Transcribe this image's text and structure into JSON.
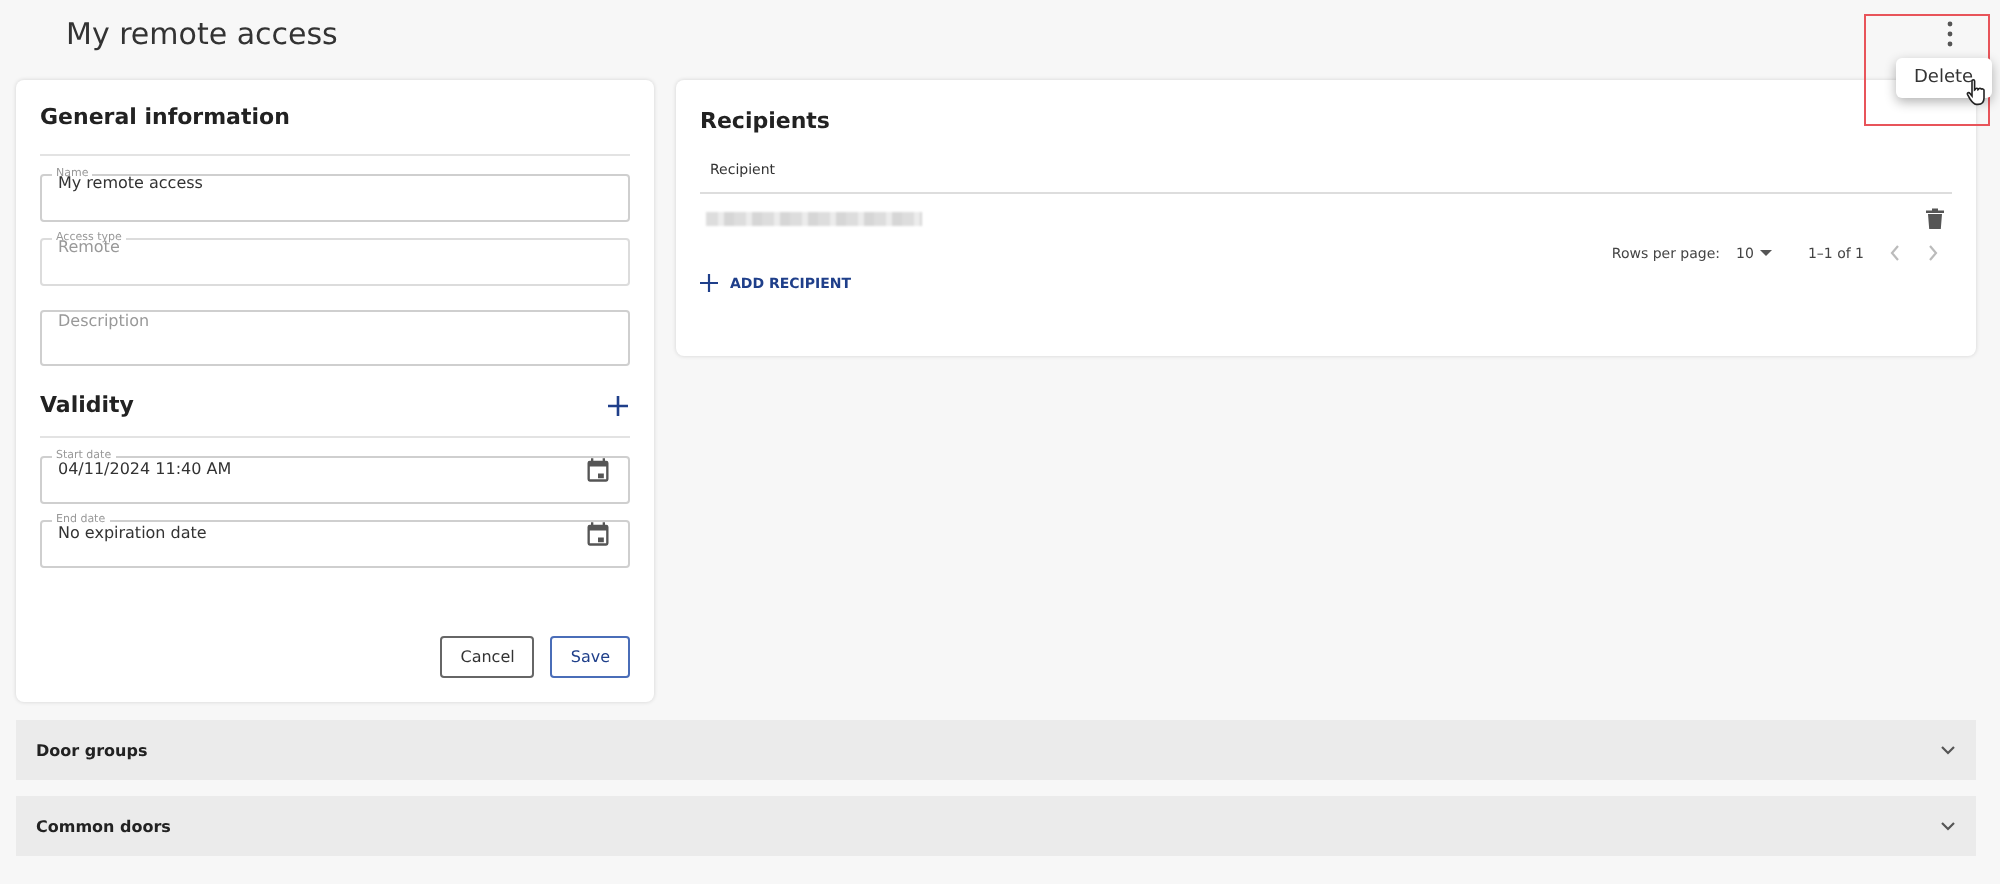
{
  "header": {
    "title": "My remote access",
    "menu": {
      "items": [
        {
          "label": "Delete"
        }
      ]
    }
  },
  "general": {
    "title": "General information",
    "fields": [
      {
        "label": "Name",
        "value": "My remote access"
      },
      {
        "label": "Access type",
        "value": "Remote",
        "disabled": true
      },
      {
        "placeholder": "Description"
      }
    ]
  },
  "validity": {
    "title": "Validity",
    "fields": [
      {
        "kind": "date",
        "label": "Start date",
        "value": "04/11/2024 11:40 AM"
      },
      {
        "kind": "date",
        "label": "End date",
        "value": "No expiration date"
      }
    ]
  },
  "actions": [
    {
      "label": "Cancel",
      "kind": "secondary"
    },
    {
      "label": "Save",
      "kind": "primary"
    }
  ],
  "recipients": {
    "title": "Recipients",
    "columns": [
      "Recipient"
    ],
    "rows": [
      {
        "kind": "redacted"
      }
    ],
    "pagination": {
      "rows_label": "Rows per page:",
      "rows_value": "10",
      "range": "1–1 of 1",
      "prev": {
        "disabled": true
      },
      "next": {
        "disabled": true
      }
    },
    "add_label": "ADD RECIPIENT"
  },
  "sections": [
    {
      "title": "Door groups",
      "expanded": false
    },
    {
      "title": "Common doors",
      "expanded": false
    }
  ]
}
